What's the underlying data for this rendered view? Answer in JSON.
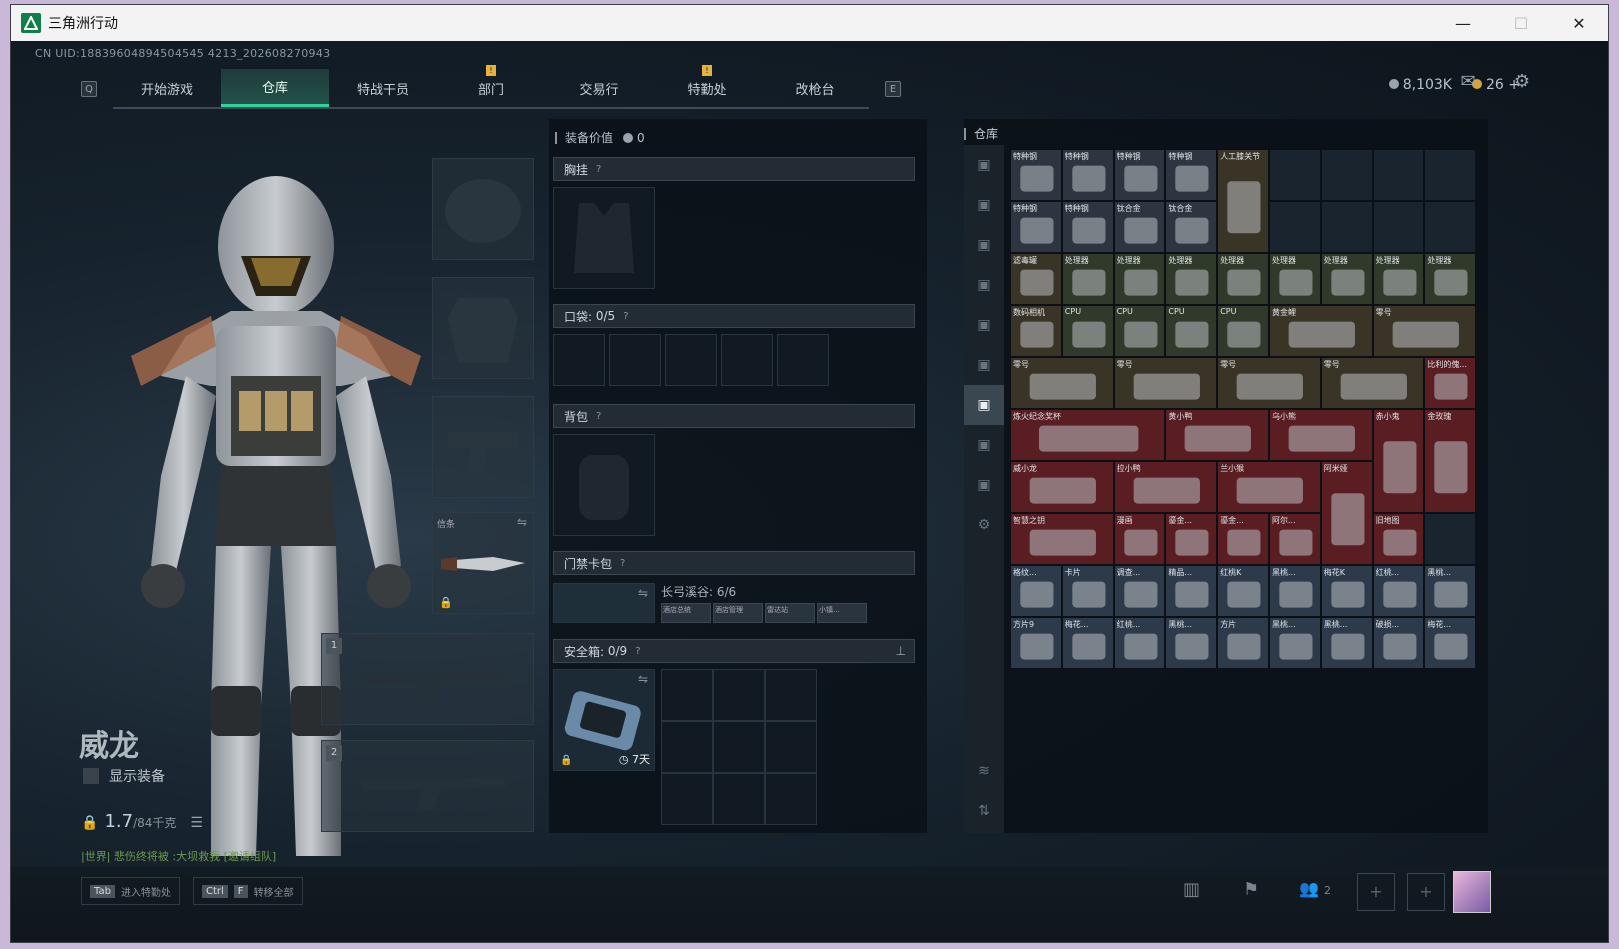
{
  "window": {
    "title": "三角洲行动"
  },
  "uid": "CN UID:18839604894504545 4213_202608270943",
  "tabs": [
    "开始游戏",
    "仓库",
    "特战干员",
    "部门",
    "交易行",
    "特勤处",
    "改枪台"
  ],
  "tab_keys": {
    "left": "Q",
    "right": "E"
  },
  "currency": {
    "silver": "8,103K",
    "gold": "26"
  },
  "character": {
    "name": "威龙",
    "show_equip_label": "显示装备",
    "weight_value": "1.7",
    "weight_max": "/84千克",
    "chat_line": "|世界| 悲伤终将被   :大坝救我  [邀请组队]"
  },
  "gear": {
    "melee_label": "信条",
    "slot1": "1",
    "slot2": "2"
  },
  "equip_panel": {
    "value_label": "装备价值",
    "value": "0",
    "chest_rig": "胸挂",
    "pocket_label": "口袋:",
    "pocket_count": "0/5",
    "backpack": "背包",
    "keycard": "门禁卡包",
    "keycard_name": "长弓溪谷: 6/6",
    "keycard_subs": [
      "酒店总统",
      "酒店管理",
      "雷达站",
      "小镇..."
    ],
    "safe_label": "安全箱:",
    "safe_count": "0/9",
    "safe_days": "7天"
  },
  "storage": {
    "title": "仓库",
    "items": [
      {
        "label": "特种钢",
        "col": 0,
        "row": 0,
        "w": 1,
        "h": 1,
        "color": "#2d3640"
      },
      {
        "label": "特种钢",
        "col": 1,
        "row": 0,
        "w": 1,
        "h": 1,
        "color": "#2d3640"
      },
      {
        "label": "特种钢",
        "col": 2,
        "row": 0,
        "w": 1,
        "h": 1,
        "color": "#2d3640"
      },
      {
        "label": "特种钢",
        "col": 3,
        "row": 0,
        "w": 1,
        "h": 1,
        "color": "#2d3640"
      },
      {
        "label": "人工膝关节",
        "col": 4,
        "row": 0,
        "w": 1,
        "h": 2,
        "color": "#3a3426"
      },
      {
        "label": "特种钢",
        "col": 0,
        "row": 1,
        "w": 1,
        "h": 1,
        "color": "#2d3640"
      },
      {
        "label": "特种钢",
        "col": 1,
        "row": 1,
        "w": 1,
        "h": 1,
        "color": "#2d3640"
      },
      {
        "label": "钛合金",
        "col": 2,
        "row": 1,
        "w": 1,
        "h": 1,
        "color": "#2d3640"
      },
      {
        "label": "钛合金",
        "col": 3,
        "row": 1,
        "w": 1,
        "h": 1,
        "color": "#2d3640"
      },
      {
        "label": "滤毒罐",
        "col": 0,
        "row": 2,
        "w": 1,
        "h": 1,
        "color": "#3a3426"
      },
      {
        "label": "处理器",
        "col": 1,
        "row": 2,
        "w": 1,
        "h": 1,
        "color": "#2f3a2a"
      },
      {
        "label": "处理器",
        "col": 2,
        "row": 2,
        "w": 1,
        "h": 1,
        "color": "#2f3a2a"
      },
      {
        "label": "处理器",
        "col": 3,
        "row": 2,
        "w": 1,
        "h": 1,
        "color": "#2f3a2a"
      },
      {
        "label": "处理器",
        "col": 4,
        "row": 2,
        "w": 1,
        "h": 1,
        "color": "#2f3a2a"
      },
      {
        "label": "处理器",
        "col": 5,
        "row": 2,
        "w": 1,
        "h": 1,
        "color": "#2f3a2a"
      },
      {
        "label": "处理器",
        "col": 6,
        "row": 2,
        "w": 1,
        "h": 1,
        "color": "#2f3a2a"
      },
      {
        "label": "处理器",
        "col": 7,
        "row": 2,
        "w": 1,
        "h": 1,
        "color": "#2f3a2a"
      },
      {
        "label": "处理器",
        "col": 8,
        "row": 2,
        "w": 1,
        "h": 1,
        "color": "#2f3a2a"
      },
      {
        "label": "数码相机",
        "col": 0,
        "row": 3,
        "w": 1,
        "h": 1,
        "color": "#3a3426"
      },
      {
        "label": "CPU",
        "col": 1,
        "row": 3,
        "w": 1,
        "h": 1,
        "color": "#2f3a2a"
      },
      {
        "label": "CPU",
        "col": 2,
        "row": 3,
        "w": 1,
        "h": 1,
        "color": "#2f3a2a"
      },
      {
        "label": "CPU",
        "col": 3,
        "row": 3,
        "w": 1,
        "h": 1,
        "color": "#2f3a2a"
      },
      {
        "label": "CPU",
        "col": 4,
        "row": 3,
        "w": 1,
        "h": 1,
        "color": "#2f3a2a"
      },
      {
        "label": "黄金鲤",
        "col": 5,
        "row": 3,
        "w": 2,
        "h": 1,
        "color": "#3a3426"
      },
      {
        "label": "零号",
        "col": 7,
        "row": 3,
        "w": 2,
        "h": 1,
        "color": "#3a3426"
      },
      {
        "label": "零号",
        "col": 0,
        "row": 4,
        "w": 2,
        "h": 1,
        "color": "#3a3426"
      },
      {
        "label": "零号",
        "col": 2,
        "row": 4,
        "w": 2,
        "h": 1,
        "color": "#3a3426"
      },
      {
        "label": "零号",
        "col": 4,
        "row": 4,
        "w": 2,
        "h": 1,
        "color": "#3a3426"
      },
      {
        "label": "零号",
        "col": 6,
        "row": 4,
        "w": 2,
        "h": 1,
        "color": "#3a3426"
      },
      {
        "label": "比利的傀...",
        "col": 8,
        "row": 4,
        "w": 1,
        "h": 1,
        "color": "#5a1e22"
      },
      {
        "label": "炼火纪念奖杯",
        "col": 0,
        "row": 5,
        "w": 3,
        "h": 1,
        "color": "#5a1e22"
      },
      {
        "label": "黄小鸭",
        "col": 3,
        "row": 5,
        "w": 2,
        "h": 1,
        "color": "#5a1e22"
      },
      {
        "label": "乌小熊",
        "col": 5,
        "row": 5,
        "w": 2,
        "h": 1,
        "color": "#5a1e22"
      },
      {
        "label": "赤小鬼",
        "col": 7,
        "row": 5,
        "w": 1,
        "h": 2,
        "color": "#5a1e22"
      },
      {
        "label": "金玫瑰",
        "col": 8,
        "row": 5,
        "w": 1,
        "h": 2,
        "color": "#5a1e22"
      },
      {
        "label": "威小龙",
        "col": 0,
        "row": 6,
        "w": 2,
        "h": 1,
        "color": "#5a1e22"
      },
      {
        "label": "拉小鸭",
        "col": 2,
        "row": 6,
        "w": 2,
        "h": 1,
        "color": "#5a1e22"
      },
      {
        "label": "兰小猴",
        "col": 4,
        "row": 6,
        "w": 2,
        "h": 1,
        "color": "#5a1e22"
      },
      {
        "label": "阿米娅",
        "col": 6,
        "row": 6,
        "w": 1,
        "h": 2,
        "color": "#5a1e22"
      },
      {
        "label": "智慧之钥",
        "col": 0,
        "row": 7,
        "w": 2,
        "h": 1,
        "color": "#5a1e22"
      },
      {
        "label": "漫画",
        "col": 2,
        "row": 7,
        "w": 1,
        "h": 1,
        "color": "#5a1e22"
      },
      {
        "label": "鎏金...",
        "col": 3,
        "row": 7,
        "w": 1,
        "h": 1,
        "color": "#5a1e22"
      },
      {
        "label": "鎏金...",
        "col": 4,
        "row": 7,
        "w": 1,
        "h": 1,
        "color": "#5a1e22"
      },
      {
        "label": "阿尔...",
        "col": 5,
        "row": 7,
        "w": 1,
        "h": 1,
        "color": "#5a1e22"
      },
      {
        "label": "旧地图",
        "col": 7,
        "row": 7,
        "w": 1,
        "h": 1,
        "color": "#5a1e22"
      },
      {
        "label": "格纹...",
        "col": 0,
        "row": 8,
        "w": 1,
        "h": 1,
        "color": "#2d3a4a"
      },
      {
        "label": "卡片",
        "col": 1,
        "row": 8,
        "w": 1,
        "h": 1,
        "color": "#2d3a4a"
      },
      {
        "label": "调查...",
        "col": 2,
        "row": 8,
        "w": 1,
        "h": 1,
        "color": "#2d3a4a"
      },
      {
        "label": "精品...",
        "col": 3,
        "row": 8,
        "w": 1,
        "h": 1,
        "color": "#2d3a4a"
      },
      {
        "label": "红桃K",
        "col": 4,
        "row": 8,
        "w": 1,
        "h": 1,
        "color": "#2d3a4a"
      },
      {
        "label": "黑桃...",
        "col": 5,
        "row": 8,
        "w": 1,
        "h": 1,
        "color": "#2d3a4a"
      },
      {
        "label": "梅花K",
        "col": 6,
        "row": 8,
        "w": 1,
        "h": 1,
        "color": "#2d3a4a"
      },
      {
        "label": "红桃...",
        "col": 7,
        "row": 8,
        "w": 1,
        "h": 1,
        "color": "#2d3a4a"
      },
      {
        "label": "黑桃...",
        "col": 8,
        "row": 8,
        "w": 1,
        "h": 1,
        "color": "#2d3a4a"
      },
      {
        "label": "方片9",
        "col": 0,
        "row": 9,
        "w": 1,
        "h": 1,
        "color": "#2d3a4a"
      },
      {
        "label": "梅花...",
        "col": 1,
        "row": 9,
        "w": 1,
        "h": 1,
        "color": "#2d3a4a"
      },
      {
        "label": "红桃...",
        "col": 2,
        "row": 9,
        "w": 1,
        "h": 1,
        "color": "#2d3a4a"
      },
      {
        "label": "黑桃...",
        "col": 3,
        "row": 9,
        "w": 1,
        "h": 1,
        "color": "#2d3a4a"
      },
      {
        "label": "方片",
        "col": 4,
        "row": 9,
        "w": 1,
        "h": 1,
        "color": "#2d3a4a"
      },
      {
        "label": "黑桃...",
        "col": 5,
        "row": 9,
        "w": 1,
        "h": 1,
        "color": "#2d3a4a"
      },
      {
        "label": "黑桃...",
        "col": 6,
        "row": 9,
        "w": 1,
        "h": 1,
        "color": "#2d3a4a"
      },
      {
        "label": "破损...",
        "col": 7,
        "row": 9,
        "w": 1,
        "h": 1,
        "color": "#2d3a4a"
      },
      {
        "label": "梅花...",
        "col": 8,
        "row": 9,
        "w": 1,
        "h": 1,
        "color": "#2d3a4a"
      }
    ]
  },
  "bottom": {
    "hint1_key": "Tab",
    "hint1_text": "进入特勤处",
    "hint2_key1": "Ctrl",
    "hint2_key2": "F",
    "hint2_text": "转移全部",
    "squad_count": "2"
  }
}
